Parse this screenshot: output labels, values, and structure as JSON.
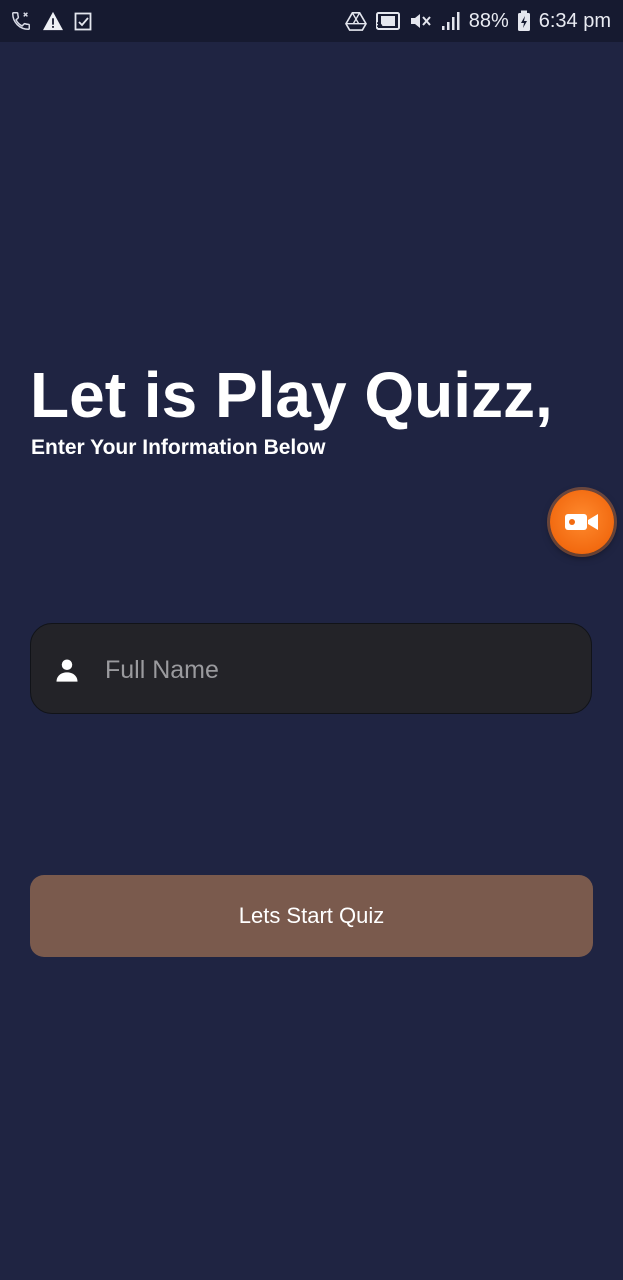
{
  "status_bar": {
    "battery": "88%",
    "time": "6:34 pm",
    "left_icons": [
      "call-icon",
      "warning-icon",
      "checkbox-icon"
    ],
    "right_icons": [
      "drive-icon",
      "cast-icon",
      "mute-icon",
      "signal-icon",
      "battery-icon"
    ]
  },
  "main": {
    "title": "Let is Play Quizz,",
    "subtitle": "Enter Your Information Below"
  },
  "form": {
    "name_placeholder": "Full Name",
    "name_value": "",
    "start_button_label": "Lets Start Quiz"
  },
  "colors": {
    "background": "#1f2442",
    "input_background": "#232328",
    "button_background": "#7a5a4d",
    "record_button": "#f26a10"
  }
}
